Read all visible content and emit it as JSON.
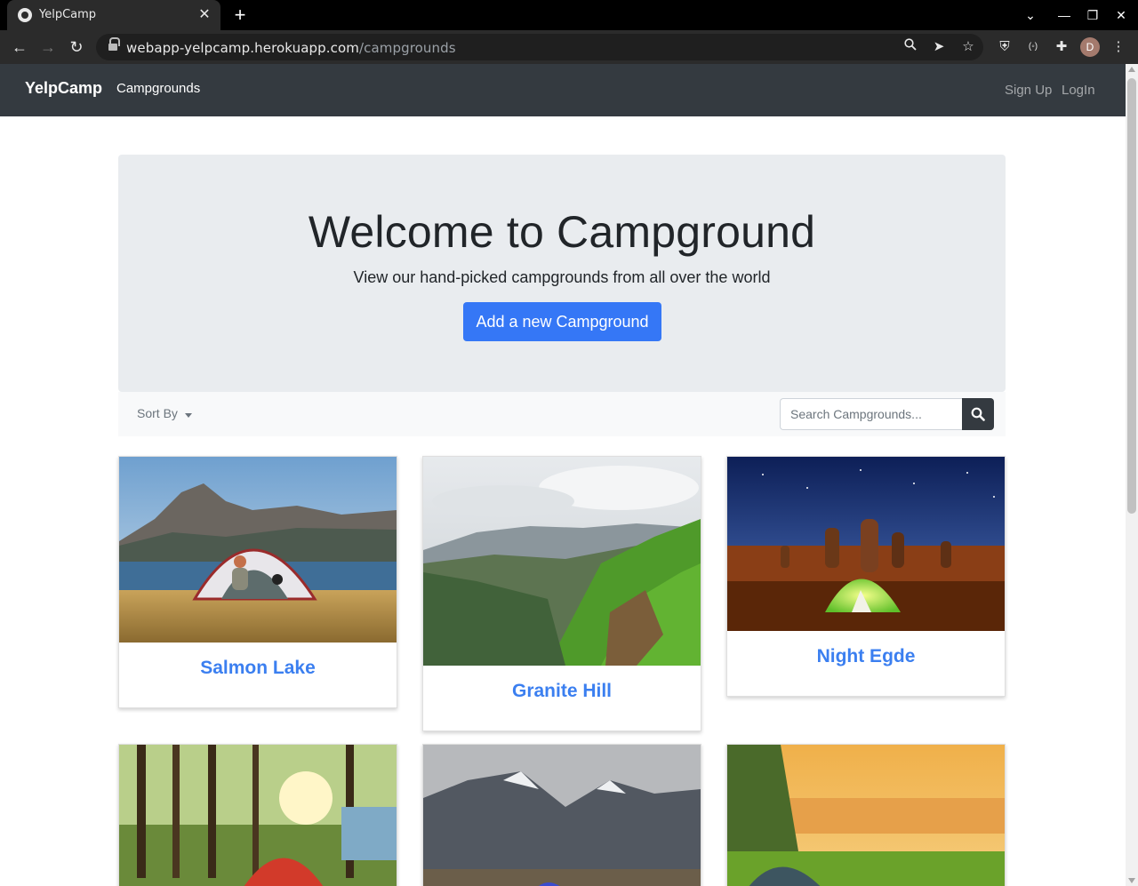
{
  "browser": {
    "tab_title": "YelpCamp",
    "url_host": "webapp-yelpcamp.herokuapp.com",
    "url_path": "/campgrounds",
    "profile_initial": "D"
  },
  "nav": {
    "brand": "YelpCamp",
    "campgrounds": "Campgrounds",
    "signup": "Sign Up",
    "login": "LogIn"
  },
  "hero": {
    "title": "Welcome to Campground",
    "lead": "View our hand-picked campgrounds from all over the world",
    "button": "Add a new Campground"
  },
  "toolbar": {
    "sort_label": "Sort By",
    "search_placeholder": "Search Campgrounds..."
  },
  "campgrounds": [
    {
      "name": "Salmon Lake"
    },
    {
      "name": "Granite Hill"
    },
    {
      "name": "Night Egde"
    },
    {
      "name": ""
    },
    {
      "name": ""
    },
    {
      "name": ""
    }
  ],
  "colors": {
    "navbar": "#343a40",
    "primary": "#3577f6",
    "card_title": "#3b7ff0",
    "jumbotron": "#e9ecef"
  }
}
